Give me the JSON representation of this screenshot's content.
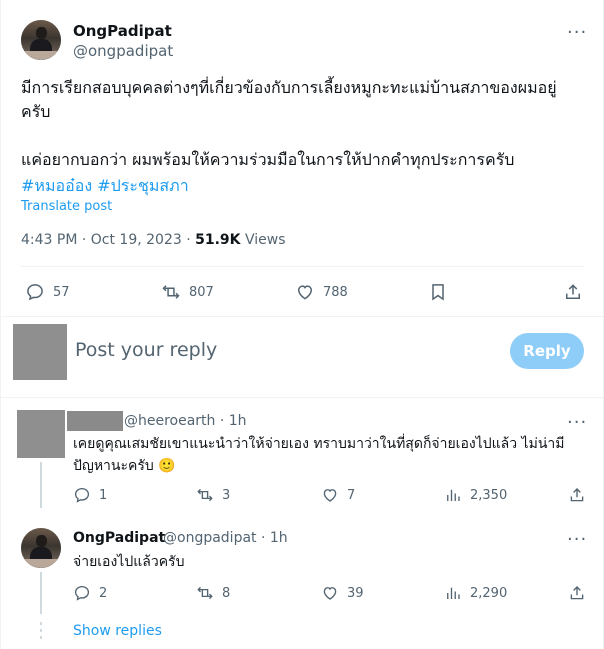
{
  "tweet": {
    "author_name": "OngPadipat",
    "author_handle": "@ongpadipat",
    "text_line1": "มีการเรียกสอบบุคคลต่างๆที่เกี่ยวข้องกับการเลี้ยงหมูกะทะแม่บ้านสภาของผมอยู่",
    "text_line2": "ครับ",
    "text_line3": "แค่อยากบอกว่า ผมพร้อมให้ความร่วมมือในการให้ปากคำทุกประการครับ",
    "hashtag1": "#หมออ๋อง",
    "hashtag2": "#ประชุมสภา",
    "translate_label": "Translate post",
    "time": "4:43 PM · Oct 19, 2023 · ",
    "views_count": "51.9K",
    "views_label": " Views",
    "replies": "57",
    "reposts": "807",
    "likes": "788",
    "more": "···"
  },
  "composer": {
    "placeholder": "Post your reply",
    "button": "Reply"
  },
  "replies": [
    {
      "handle_time": "@heeroearth · 1h",
      "text_line1": "เคยดูคุณเสมชัยเขาแนะนำว่าให้จ่ายเอง ทราบมาว่าในที่สุดก็จ่ายเองไปแล้ว ไม่น่ามี",
      "text_line2": "ปัญหานะครับ 🙂",
      "replies": "1",
      "reposts": "3",
      "likes": "7",
      "views": "2,350",
      "more": "···"
    },
    {
      "name": "OngPadipat",
      "handle_time": "@ongpadipat · 1h",
      "text": "จ่ายเองไปแล้วครับ",
      "replies": "2",
      "reposts": "8",
      "likes": "39",
      "views": "2,290",
      "more": "···"
    }
  ],
  "show_replies": "Show replies",
  "icons": {
    "reply": "reply-icon",
    "repost": "repost-icon",
    "like": "like-icon",
    "bookmark": "bookmark-icon",
    "share": "share-icon",
    "views": "views-icon"
  },
  "colors": {
    "accent": "#1d9bf0",
    "reply_button": "#8ecdf8",
    "secondary_text": "#536471"
  }
}
